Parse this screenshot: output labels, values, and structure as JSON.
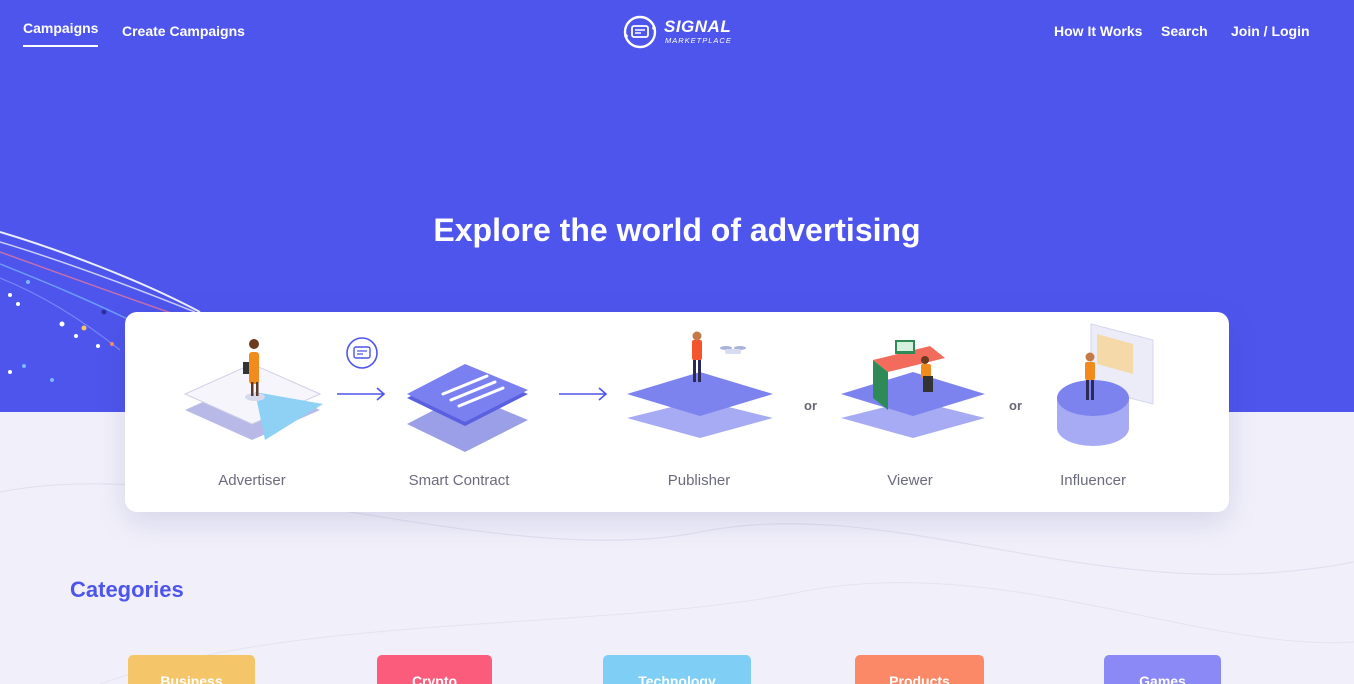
{
  "nav": {
    "campaigns": "Campaigns",
    "create_campaigns": "Create Campaigns",
    "how_it_works": "How It Works",
    "search": "Search",
    "join_login": "Join / Login"
  },
  "logo": {
    "name": "SIGNAL",
    "subtitle": "MARKETPLACE"
  },
  "hero": {
    "title": "Explore the world of advertising"
  },
  "flow": {
    "steps": [
      {
        "label": "Advertiser",
        "icon": "advertiser-illustration"
      },
      {
        "label": "Smart Contract",
        "icon": "smart-contract-illustration"
      },
      {
        "label": "Publisher",
        "icon": "publisher-illustration"
      },
      {
        "label": "Viewer",
        "icon": "viewer-illustration"
      },
      {
        "label": "Influencer",
        "icon": "influencer-illustration"
      }
    ],
    "or": "or"
  },
  "categories": {
    "title": "Categories",
    "items": [
      {
        "label": "Business",
        "color": "#f5c56a"
      },
      {
        "label": "Crypto",
        "color": "#fb5c7c"
      },
      {
        "label": "Technology",
        "color": "#7ecef5"
      },
      {
        "label": "Products",
        "color": "#fb8866"
      },
      {
        "label": "Games",
        "color": "#8b89f5"
      }
    ]
  },
  "colors": {
    "brand": "#4d55ec",
    "background": "#f1f0fa"
  }
}
